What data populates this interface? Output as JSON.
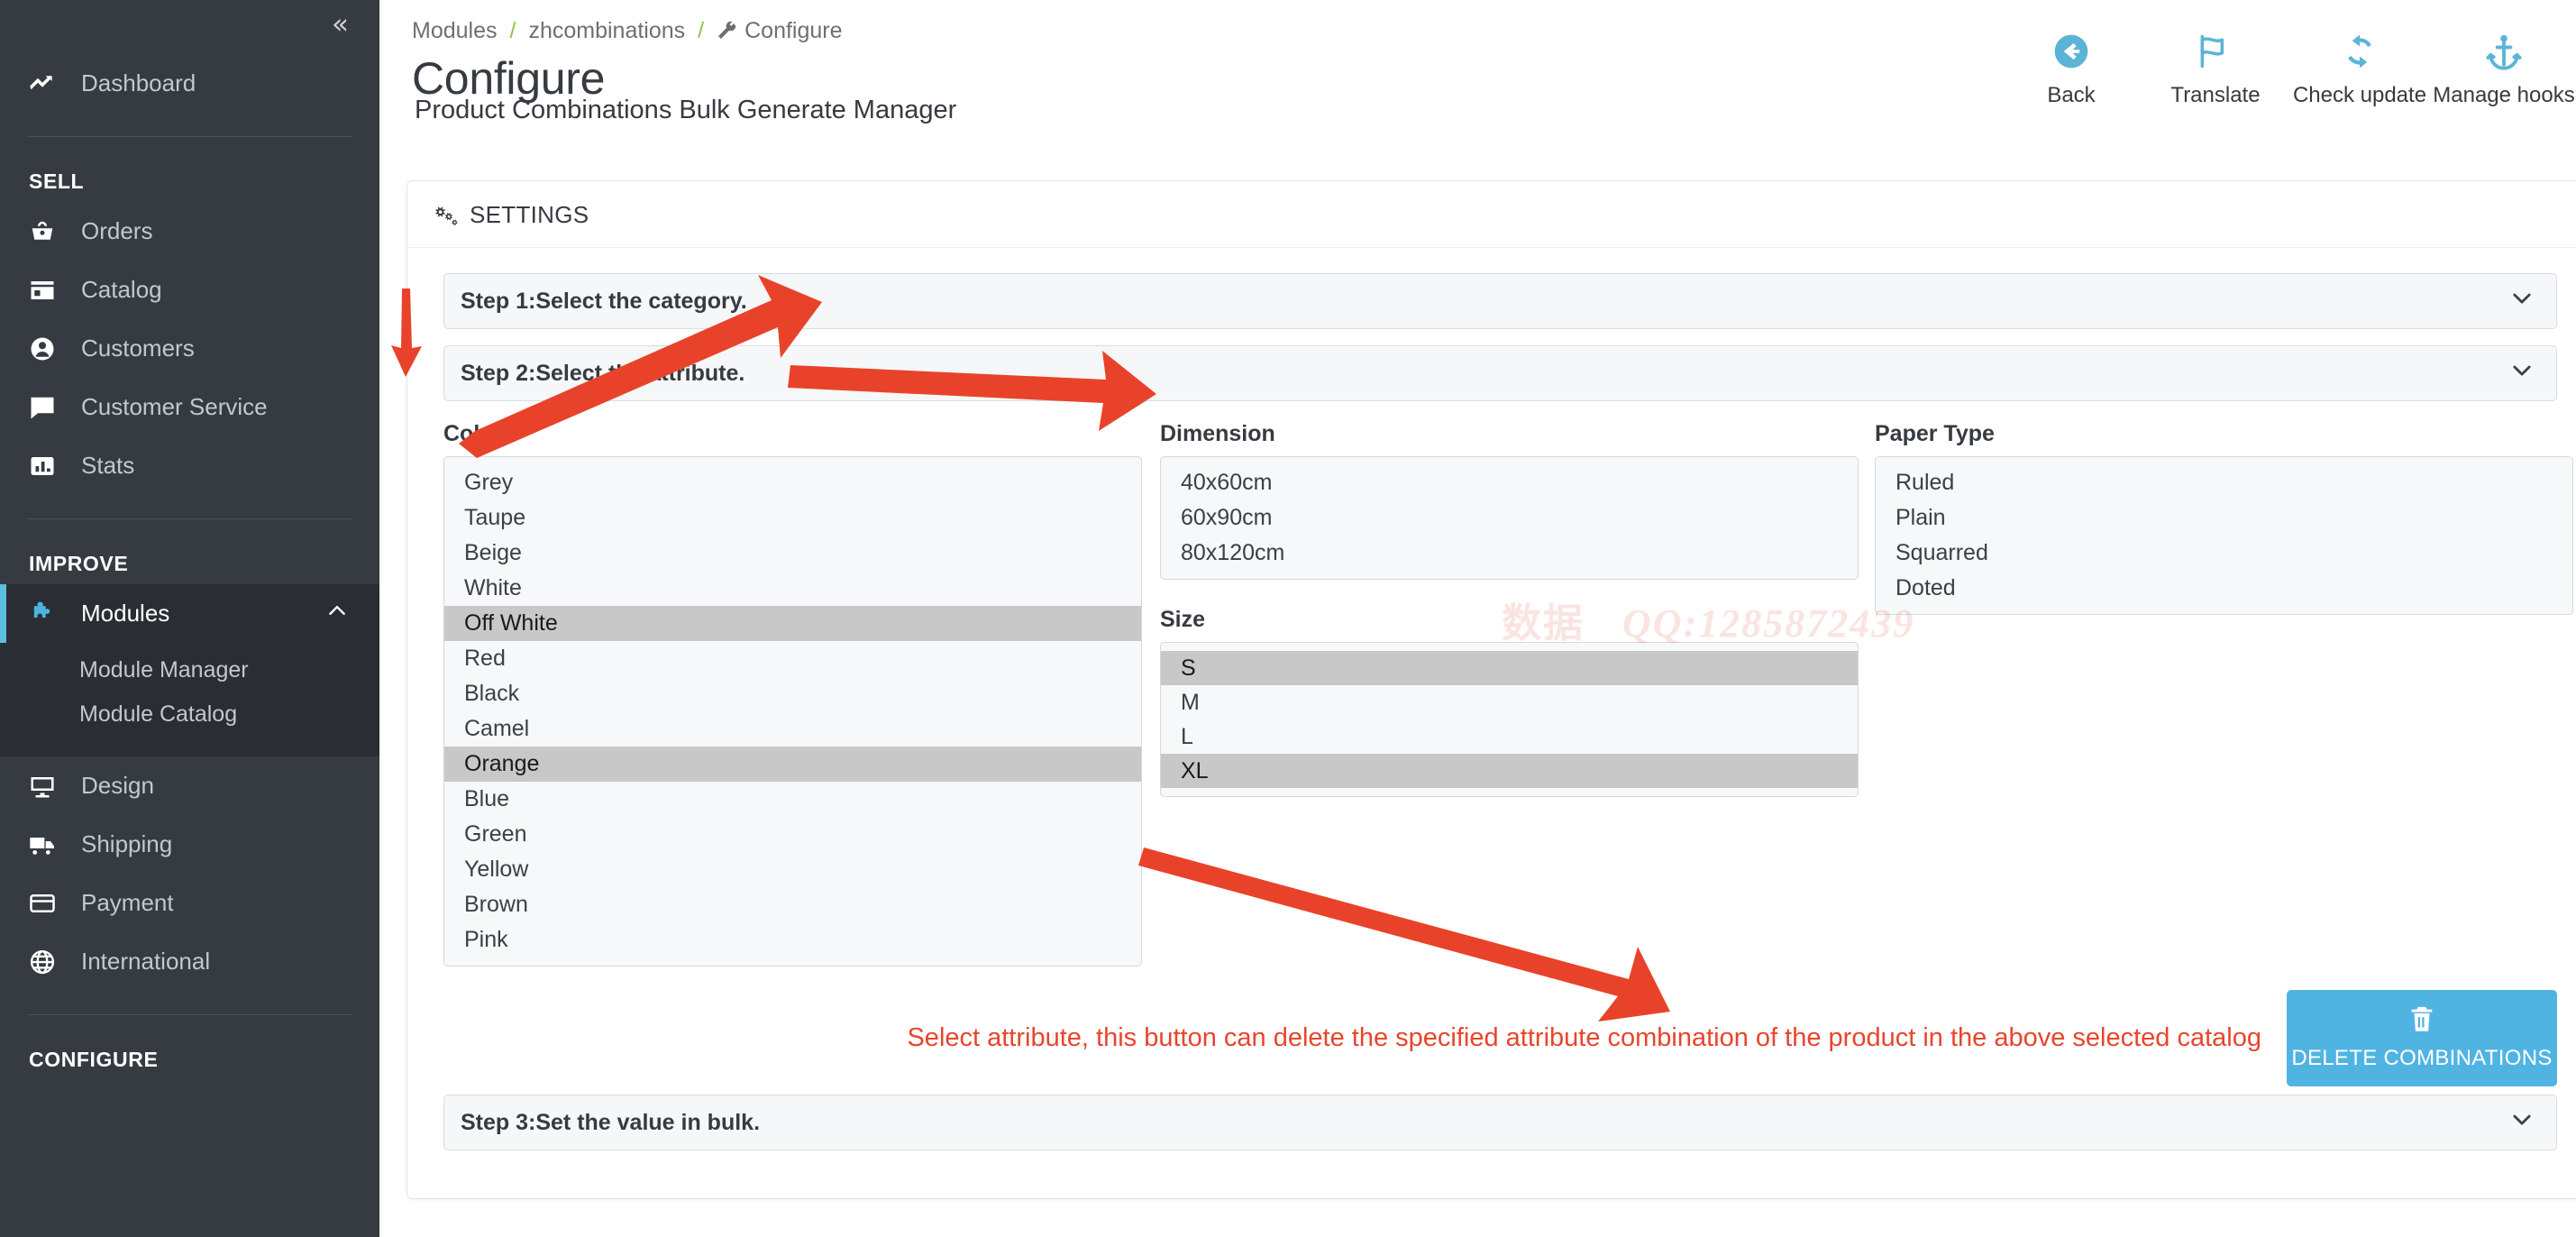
{
  "sidebar": {
    "collapse_icon": "double-chevron-left-icon",
    "top_items": [
      {
        "label": "Dashboard",
        "icon": "trend-line-icon"
      }
    ],
    "sections": [
      {
        "title": "SELL",
        "items": [
          {
            "label": "Orders",
            "icon": "basket-icon"
          },
          {
            "label": "Catalog",
            "icon": "store-icon"
          },
          {
            "label": "Customers",
            "icon": "person-circle-icon"
          },
          {
            "label": "Customer Service",
            "icon": "chat-icon"
          },
          {
            "label": "Stats",
            "icon": "bar-chart-icon"
          }
        ]
      },
      {
        "title": "IMPROVE",
        "items": [
          {
            "label": "Modules",
            "icon": "puzzle-icon",
            "active": true,
            "expanded": true,
            "children": [
              {
                "label": "Module Manager"
              },
              {
                "label": "Module Catalog"
              }
            ]
          },
          {
            "label": "Design",
            "icon": "monitor-icon"
          },
          {
            "label": "Shipping",
            "icon": "truck-icon"
          },
          {
            "label": "Payment",
            "icon": "credit-card-icon"
          },
          {
            "label": "International",
            "icon": "globe-icon"
          }
        ]
      },
      {
        "title": "CONFIGURE",
        "items": []
      }
    ]
  },
  "header": {
    "breadcrumb": {
      "items": [
        "Modules",
        "zhcombinations",
        "Configure"
      ],
      "separator": "/",
      "last_icon": "wrench-icon"
    },
    "title": "Configure",
    "subtitle": "Product Combinations Bulk Generate Manager",
    "toolbar": [
      {
        "label": "Back",
        "icon": "arrow-left-circle-icon"
      },
      {
        "label": "Translate",
        "icon": "flag-icon"
      },
      {
        "label": "Check update",
        "icon": "refresh-icon"
      },
      {
        "label": "Manage hooks",
        "icon": "anchor-icon"
      }
    ]
  },
  "settings_card": {
    "title": "SETTINGS",
    "title_icon": "gears-icon",
    "steps": {
      "step1": "Step 1:Select the category.",
      "step2": "Step 2:Select the attribute.",
      "step3": "Step 3:Set the value in bulk."
    },
    "chevron_icon": "chevron-down-icon",
    "attributes": [
      {
        "label": "Color",
        "options": [
          "Grey",
          "Taupe",
          "Beige",
          "White",
          "Off White",
          "Red",
          "Black",
          "Camel",
          "Orange",
          "Blue",
          "Green",
          "Yellow",
          "Brown",
          "Pink"
        ],
        "selected": [
          "Off White",
          "Orange"
        ]
      },
      {
        "label": "Dimension",
        "options": [
          "40x60cm",
          "60x90cm",
          "80x120cm"
        ],
        "selected": []
      },
      {
        "label": "Size",
        "options": [
          "S",
          "M",
          "L",
          "XL"
        ],
        "selected": [
          "S",
          "XL"
        ]
      },
      {
        "label": "Paper Type",
        "options": [
          "Ruled",
          "Plain",
          "Squarred",
          "Doted"
        ],
        "selected": []
      }
    ],
    "warning_text": "Select attribute, this button can delete the specified attribute combination of the product in the above selected catalog",
    "delete_button": {
      "label": "DELETE COMBINATIONS",
      "icon": "trash-icon"
    }
  },
  "watermark": {
    "cjk": "数据",
    "text": "QQ:1285872439"
  },
  "colors": {
    "accent": "#50b4e3",
    "sidebar_bg": "#363a41",
    "warning": "#e8452c",
    "annotation_arrow": "#e8432a",
    "breadcrumb_sep": "#8cc63f",
    "selected_option_bg": "#c8c8c8"
  }
}
